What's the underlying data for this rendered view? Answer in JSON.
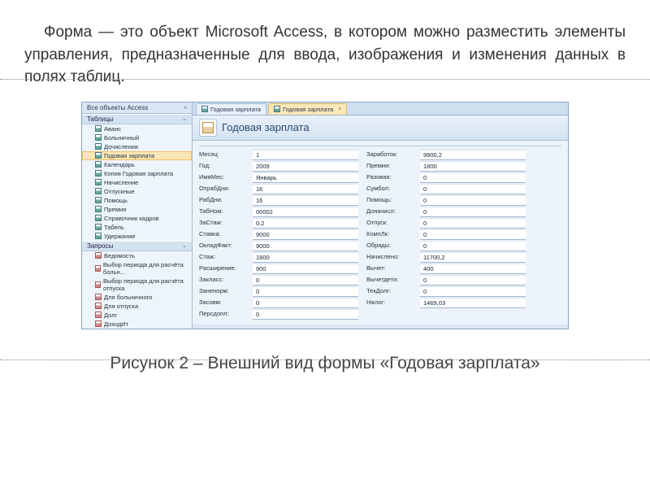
{
  "paragraph": "Форма — это объект Microsoft Access, в котором можно разместить элементы управления, предназначенные для ввода, изображения и изменения данных в полях таблиц.",
  "caption": "Рисунок 2 – Внешний вид формы «Годовая зарплата»",
  "screenshot": {
    "nav_header": "Все объекты Access",
    "group_tables": "Таблицы",
    "group_queries": "Запросы",
    "tables": [
      "Аванс",
      "Больничный",
      "Дочисления",
      "Годовая зарплата",
      "Календарь",
      "Копия Годовая зарплата",
      "Начисление",
      "Отпускные",
      "Помощь",
      "Премия",
      "Справочник кадров",
      "Табель",
      "Удержание"
    ],
    "tables_selected_index": 3,
    "queries": [
      "Ведомость",
      "Выбор периода для расчёта больн...",
      "Выбор периода для расчёта отпуска",
      "Для больничного",
      "Для отпуска",
      "Долг",
      "ДоходИт"
    ],
    "tab1": "Годовая зарплата",
    "tab2": "Годовая зарплата",
    "form_title": "Годовая зарплата",
    "fields_left": [
      {
        "l": "Месяц:",
        "v": "1"
      },
      {
        "l": "Год:",
        "v": "2009"
      },
      {
        "l": "ИмяМес:",
        "v": "Январь"
      },
      {
        "l": "ОтрабДни:",
        "v": "16"
      },
      {
        "l": "РабДни:",
        "v": "16"
      },
      {
        "l": "ТабНом:",
        "v": "00002"
      },
      {
        "l": "ЗаСтаж:",
        "v": "0,2"
      },
      {
        "l": "Ставка:",
        "v": "9000"
      },
      {
        "l": "ОкладФакт:",
        "v": "9000"
      },
      {
        "l": "Стаж:",
        "v": "1800"
      },
      {
        "l": "Расширение:",
        "v": "900"
      },
      {
        "l": "Закласс:",
        "v": "0"
      },
      {
        "l": "Заненорм:",
        "v": "0"
      },
      {
        "l": "Засовм:",
        "v": "0"
      },
      {
        "l": "Персдопл:",
        "v": "0"
      }
    ],
    "fields_right": [
      {
        "l": "Заработок:",
        "v": "9900,2"
      },
      {
        "l": "Премии:",
        "v": "1800"
      },
      {
        "l": "Разовая:",
        "v": "0"
      },
      {
        "l": "Сумбол:",
        "v": "0"
      },
      {
        "l": "Помощь:",
        "v": "0"
      },
      {
        "l": "Доначисл:",
        "v": "0"
      },
      {
        "l": "Отпуск:",
        "v": "0"
      },
      {
        "l": "КомпЛк:",
        "v": "0"
      },
      {
        "l": "Обряды:",
        "v": "0"
      },
      {
        "l": "Начислено:",
        "v": "11700,2"
      },
      {
        "l": "Вычет:",
        "v": "400"
      },
      {
        "l": "Вычетдети:",
        "v": "0"
      },
      {
        "l": "ТекДолг:",
        "v": "0"
      },
      {
        "l": "Налог:",
        "v": "1469,03"
      }
    ]
  }
}
